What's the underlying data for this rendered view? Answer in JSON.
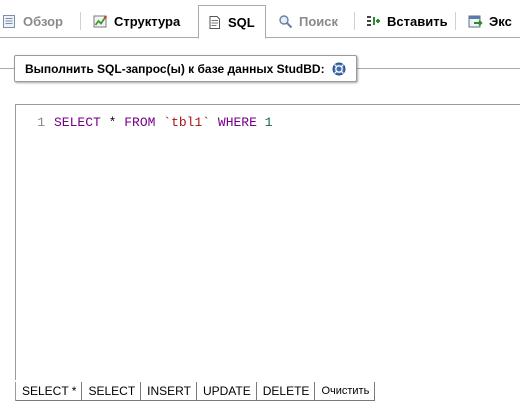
{
  "tabs": [
    {
      "label": "Обзор",
      "icon": "browse-icon",
      "state": "disabled"
    },
    {
      "label": "Структура",
      "icon": "structure-icon",
      "state": "normal"
    },
    {
      "label": "SQL",
      "icon": "sql-icon",
      "state": "active"
    },
    {
      "label": "Поиск",
      "icon": "search-icon",
      "state": "disabled"
    },
    {
      "label": "Вставить",
      "icon": "insert-icon",
      "state": "normal"
    },
    {
      "label": "Экс",
      "icon": "export-icon",
      "state": "normal"
    }
  ],
  "legend": {
    "text": "Выполнить SQL-запрос(ы) к базе данных StudBD:",
    "help_icon": "help-icon"
  },
  "editor": {
    "line_number": "1",
    "tokens": {
      "select": "SELECT",
      "star": "*",
      "from": "FROM",
      "table": "`tbl1`",
      "where": "WHERE",
      "value": "1"
    }
  },
  "buttons": {
    "select_star": "SELECT *",
    "select": "SELECT",
    "insert": "INSERT",
    "update": "UPDATE",
    "delete": "DELETE",
    "clear": "Очистить"
  },
  "colors": {
    "keyword": "#770088",
    "string": "#aa1111",
    "number": "#116644",
    "disabled_text": "#8a8a8a",
    "border": "#aaaaaa"
  }
}
